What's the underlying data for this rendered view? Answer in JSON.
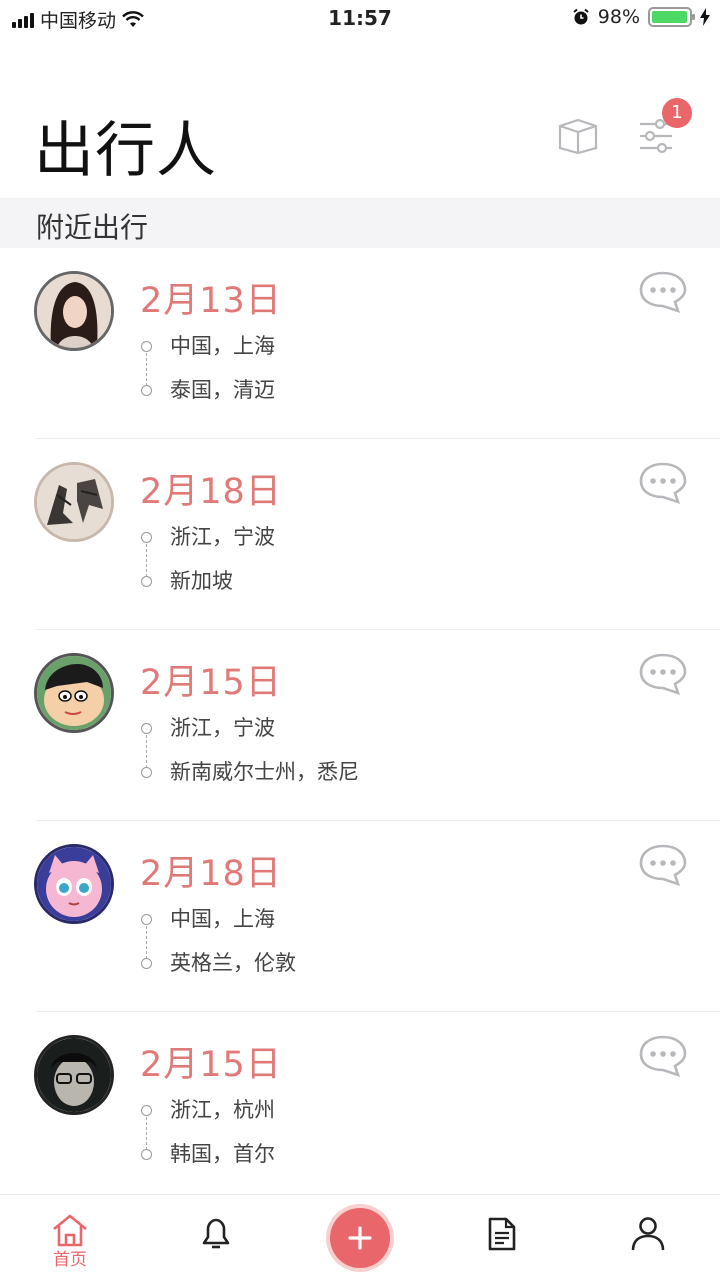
{
  "status_bar": {
    "carrier": "中国移动",
    "time": "11:57",
    "battery_pct": "98%",
    "battery_level": 0.98,
    "icons": [
      "signal-icon",
      "wifi-icon",
      "alarm-icon",
      "battery-icon",
      "charging-icon"
    ]
  },
  "header": {
    "title": "出行人",
    "filter_badge": "1",
    "icons": [
      "box-icon",
      "filter-icon"
    ]
  },
  "section": {
    "title": "附近出行"
  },
  "trips": [
    {
      "date": "2月13日",
      "from": "中国，上海",
      "to": "泰国，清迈",
      "avatar": "avatar-photo-woman"
    },
    {
      "date": "2月18日",
      "from": "浙江，宁波",
      "to": "新加坡",
      "avatar": "avatar-sketch"
    },
    {
      "date": "2月15日",
      "from": "浙江，宁波",
      "to": "新南威尔士州，悉尼",
      "avatar": "avatar-cartoon-boy"
    },
    {
      "date": "2月18日",
      "from": "中国，上海",
      "to": "英格兰，伦敦",
      "avatar": "avatar-cartoon-pink"
    },
    {
      "date": "2月15日",
      "from": "浙江，杭州",
      "to": "韩国，首尔",
      "avatar": "avatar-photo-man"
    }
  ],
  "tab_bar": {
    "home_label": "首页",
    "tabs": [
      "home-icon",
      "bell-icon",
      "add-icon",
      "document-icon",
      "profile-icon"
    ]
  },
  "colors": {
    "accent": "#e9676a",
    "date": "#e07a78",
    "section_bg": "#f4f4f6",
    "battery": "#4cd964"
  }
}
